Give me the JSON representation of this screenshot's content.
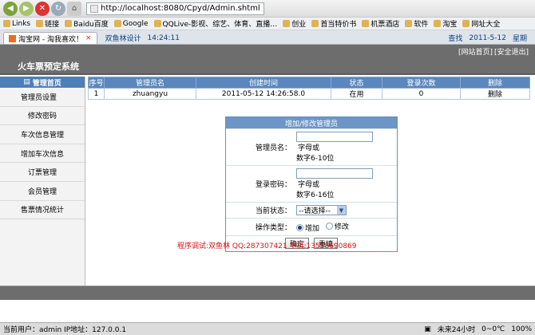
{
  "browser": {
    "url": "http://localhost:8080/Cpyd/Admin.shtml",
    "bookmarks": [
      "Links",
      "链接",
      "Baidu百度",
      "Google",
      "QQLive-影视、综艺、体育、直播…",
      "创业",
      "首当特价书",
      "机票酒店",
      "软件",
      "淘宝",
      "网址大全"
    ],
    "tab_title": "淘宝网 - 淘我喜欢！",
    "tab_clock_name": "双鱼林设计",
    "tab_clock_time": "14:24:11",
    "tab_right": "查找",
    "tab_date": "2011-5-12",
    "tab_last": "星期"
  },
  "header": {
    "title": "火车票预定系统",
    "home_link": "[网站首页]",
    "logout_link": "[安全退出]"
  },
  "sidebar": {
    "head": "管理首页",
    "items": [
      "管理员设置",
      "修改密码",
      "车次信息管理",
      "增加车次信息",
      "订票管理",
      "会员管理",
      "售票情况统计"
    ]
  },
  "table": {
    "headers": [
      "序号",
      "管理员名",
      "创建时间",
      "状态",
      "登录次数",
      "删除"
    ],
    "rows": [
      [
        "1",
        "zhuangyu",
        "2011-05-12 14:26:58.0",
        "在用",
        "0",
        "删除"
      ]
    ]
  },
  "form": {
    "title": "增加/修改管理员",
    "name_label": "管理员名：",
    "name_hint_right": "字母或",
    "name_hint_below": "数字6-10位",
    "pwd_label": "登录密码：",
    "pwd_hint_right": "字母或",
    "pwd_hint_below": "数字6-16位",
    "status_label": "当前状态：",
    "status_value": "--请选择--",
    "optype_label": "操作类型：",
    "opt_add": "增加",
    "opt_modify": "修改",
    "ok": "确定",
    "reset": "重填"
  },
  "credit": "程序调试:双鱼林 QQ:287307421 手机:13558690869",
  "status": {
    "left": "当前用户：admin IP地址：127.0.0.1",
    "net": "未来24小时",
    "temp": "0~0℃",
    "zoom": "100%"
  }
}
